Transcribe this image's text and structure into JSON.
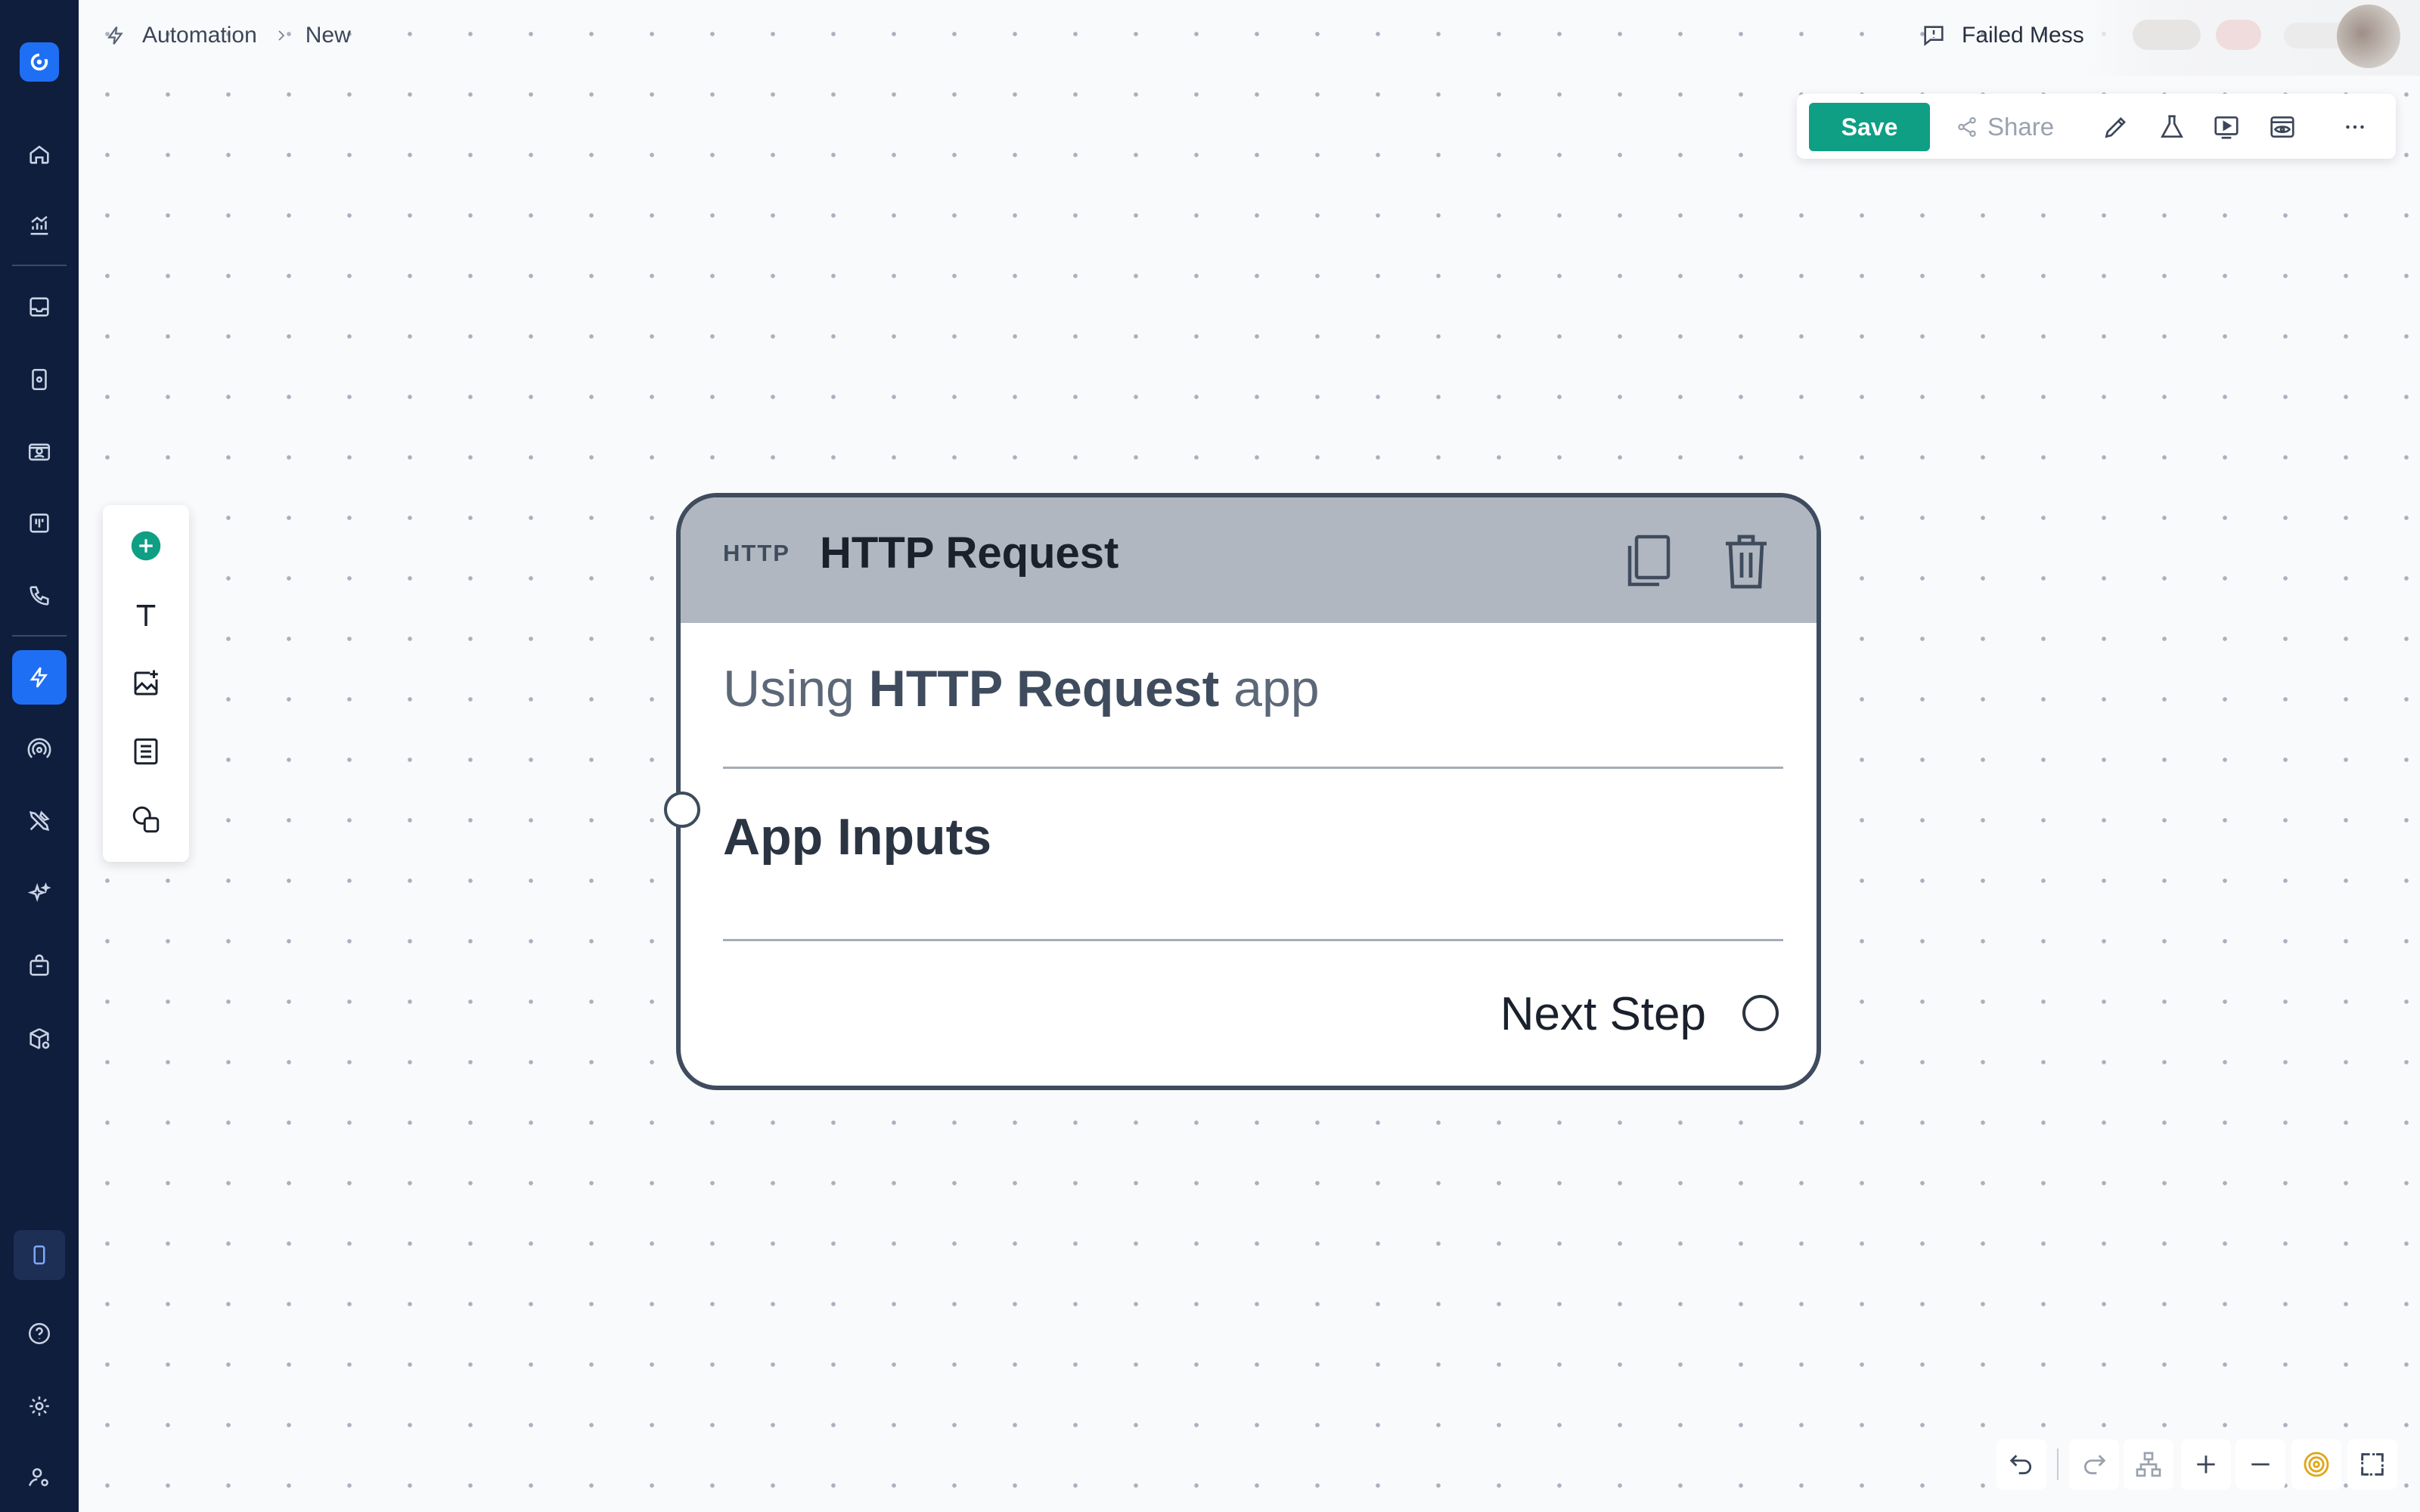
{
  "sidebar": {
    "logo": "app-logo",
    "items": [
      {
        "icon": "home-icon"
      },
      {
        "icon": "analytics-icon"
      },
      {
        "icon": "inbox-icon"
      },
      {
        "icon": "device-icon"
      },
      {
        "icon": "contacts-icon"
      },
      {
        "icon": "board-icon"
      },
      {
        "icon": "phone-icon"
      },
      {
        "icon": "automation-icon",
        "active": true
      },
      {
        "icon": "broadcast-icon"
      },
      {
        "icon": "tools-icon"
      },
      {
        "icon": "ai-sparkle-icon"
      },
      {
        "icon": "marketplace-icon"
      },
      {
        "icon": "package-settings-icon"
      }
    ],
    "bottom": [
      {
        "icon": "mobile-preview-icon"
      },
      {
        "icon": "help-icon"
      },
      {
        "icon": "settings-icon"
      },
      {
        "icon": "user-settings-icon"
      }
    ],
    "colors": {
      "background": "#0f1e3d",
      "active": "#1f6ff5"
    }
  },
  "breadcrumb": {
    "icon": "lightning-icon",
    "items": [
      "Automation",
      "New"
    ]
  },
  "header": {
    "failed_messages_label": "Failed Mess",
    "failed_messages_icon": "message-alert-icon"
  },
  "toolbar": {
    "save_label": "Save",
    "share_label": "Share",
    "icons": [
      "pencil-icon",
      "flask-icon",
      "play-preview-icon",
      "eye-preview-icon",
      "more-icon"
    ],
    "save_color": "#0e9f84"
  },
  "palette": {
    "items": [
      "add-node-icon",
      "text-tool-icon",
      "image-tool-icon",
      "note-tool-icon",
      "shapes-tool-icon"
    ]
  },
  "node": {
    "tag": "HTTP",
    "title": "HTTP Request",
    "using_prefix": "Using ",
    "using_app": "HTTP Request",
    "using_suffix": " app",
    "section_label": "App Inputs",
    "next_step_label": "Next Step",
    "header_icons": [
      "copy-icon",
      "trash-icon"
    ],
    "border_color": "#3f4c5e",
    "header_color": "#b1b7c0"
  },
  "canvas_controls": {
    "icons": [
      "undo-icon",
      "redo-icon",
      "auto-layout-icon",
      "zoom-in-icon",
      "zoom-out-icon",
      "focus-target-icon",
      "fit-view-icon"
    ]
  }
}
